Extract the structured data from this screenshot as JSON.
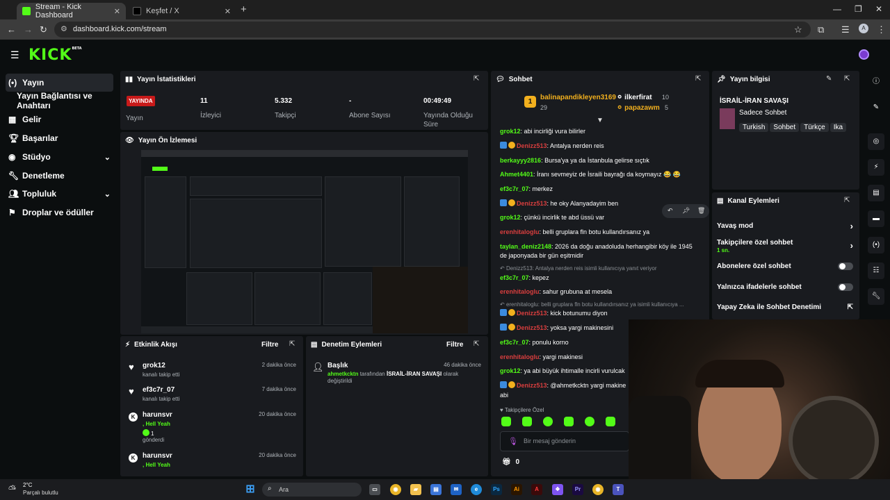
{
  "browser": {
    "tabs": [
      {
        "title": "Stream - Kick Dashboard",
        "active": true
      },
      {
        "title": "Keşfet / X",
        "active": false
      }
    ],
    "url": "dashboard.kick.com/stream",
    "profile_letter": "A"
  },
  "app": {
    "logo": "KICK",
    "logo_sup": "BETA"
  },
  "sidebar": {
    "items": [
      {
        "label": "Yayın",
        "icon": "broadcast-icon",
        "active": true
      },
      {
        "label": "Yayın Bağlantısı ve Anahtarı",
        "icon": "",
        "active": false
      },
      {
        "label": "Gelir",
        "icon": "chart-icon",
        "active": false
      },
      {
        "label": "Başarılar",
        "icon": "trophy-icon",
        "active": false
      },
      {
        "label": "Stüdyo",
        "icon": "palette-icon",
        "active": false,
        "chevron": true
      },
      {
        "label": "Denetleme",
        "icon": "wrench-icon",
        "active": false
      },
      {
        "label": "Topluluk",
        "icon": "people-icon",
        "active": false,
        "chevron": true
      },
      {
        "label": "Droplar ve ödüller",
        "icon": "gift-icon",
        "active": false
      }
    ]
  },
  "stats": {
    "title": "Yayın İstatistikleri",
    "live_badge": "YAYINDA",
    "live_label": "Yayın",
    "viewers_value": "11",
    "viewers_label": "İzleyici",
    "followers_value": "5.332",
    "followers_label": "Takipçi",
    "subs_value": "-",
    "subs_label": "Abone Sayısı",
    "duration_value": "00:49:49",
    "duration_label": "Yayında Olduğu Süre"
  },
  "preview": {
    "title": "Yayın Ön İzlemesi"
  },
  "events": {
    "title": "Etkinlik Akışı",
    "filter": "Filtre",
    "items": [
      {
        "name": "grok12",
        "sub": "kanalı takip etti",
        "time": "2 dakika önce",
        "icon": "heart-icon"
      },
      {
        "name": "ef3c7r_07",
        "sub": "kanalı takip etti",
        "time": "7 dakika önce",
        "icon": "heart-icon"
      },
      {
        "name": "harunsvr",
        "sub": ", Hell Yeah",
        "sub2": "1",
        "sub3": "gönderdi",
        "time": "20 dakika önce",
        "icon": "kick-icon"
      },
      {
        "name": "harunsvr",
        "sub": ", Hell Yeah",
        "time": "20 dakika önce",
        "icon": "kick-icon"
      }
    ]
  },
  "mod_actions": {
    "title": "Denetim Eylemleri",
    "filter": "Filtre",
    "item": {
      "title": "Başlık",
      "time": "46 dakika önce",
      "user": "ahmetkcktn",
      "middle": "tarafından",
      "target": "İSRAİL-İRAN SAVAŞI",
      "rest": "olarak",
      "rest2": "değiştirildi"
    }
  },
  "chat": {
    "title": "Sohbet",
    "top_gifter": {
      "name": "balinapandikleyen3169",
      "rank": "1",
      "count": "29"
    },
    "gifter2": {
      "name": "ilkerfirat",
      "count": "10"
    },
    "gifter3": {
      "name": "papazawm",
      "count": "5"
    },
    "messages": [
      {
        "user": "grok12",
        "color": "g",
        "text": ": abi incirliği vura bilirler"
      },
      {
        "user": "Denizz513",
        "color": "r",
        "text": ": Antalya nerden reis",
        "badges": true
      },
      {
        "user": "berkayyy2816",
        "color": "g",
        "text": ": Bursa'ya ya da İstanbula gelirse sıçtık"
      },
      {
        "user": "Ahmet4401",
        "color": "g",
        "text": ": İranı sevmeyiz de İsraili bayrağı da koymayız 😂 😂"
      },
      {
        "user": "ef3c7r_07",
        "color": "g",
        "text": ": merkez"
      },
      {
        "user": "Denizz513",
        "color": "r",
        "text": ": he oky Alanyadayim ben",
        "badges": true
      },
      {
        "user": "grok12",
        "color": "g",
        "text": ": çünkü incirlik te abd üssü var"
      },
      {
        "user": "erenhitaloglu",
        "color": "r",
        "text": ": belli gruplara fln botu kullandırsanız ya"
      },
      {
        "user": "tayIan_deniz2148",
        "color": "g",
        "text": ": 2026 da doğu anadoluda herhangibir köy ile 1945"
      },
      {
        "user": "",
        "color": "g",
        "text": "de japonyada bir gün eşitmidir"
      },
      {
        "user": "ef3c7r_07",
        "color": "g",
        "text": ": kepez"
      },
      {
        "user": "erenhitaloglu",
        "color": "r",
        "text": ": sahur grubuna at mesela"
      },
      {
        "user": "Denizz513",
        "color": "r",
        "text": ": kick botunumu diyon",
        "badges": true
      },
      {
        "user": "Denizz513",
        "color": "r",
        "text": ": yoksa yargi makinesini",
        "badges": true
      },
      {
        "user": "ef3c7r_07",
        "color": "g",
        "text": ": ponulu korno"
      },
      {
        "user": "erenhitaloglu",
        "color": "r",
        "text": ": yargi makinesi"
      },
      {
        "user": "grok12",
        "color": "g",
        "text": ": ya abi büyük ihtimalle incirli vurulcak"
      },
      {
        "user": "Denizz513",
        "color": "r",
        "text": ": @ahmetkcktn yargi makine",
        "badges": true
      },
      {
        "user": "",
        "color": "g",
        "text": "abi"
      }
    ],
    "reply1": "Denizz513: Antalya nerden reis isimli kullanıcıya yanıt veriyor",
    "reply2": "erenhitaloglu: belli gruplara fln botu kullandırsanız ya isimli kullanıcıya ...",
    "followers_only": "Takipçilere Özel",
    "input_placeholder": "Bir mesaj gönderin",
    "bottom_count": "0"
  },
  "stream_info": {
    "title": "Yayın bilgisi",
    "stream_title": "İSRAİL-İRAN SAVAŞI",
    "category": "Sadece Sohbet",
    "tags": [
      "Turkish",
      "Sohbet",
      "Türkçe",
      "Ika"
    ]
  },
  "channel_actions": {
    "title": "Kanal Eylemleri",
    "items": [
      {
        "label": "Yavaş mod",
        "type": "chevron"
      },
      {
        "label": "Takipçilere özel sohbet",
        "sub": "1 sn.",
        "type": "chevron"
      },
      {
        "label": "Abonelere özel sohbet",
        "type": "toggle"
      },
      {
        "label": "Yalnızca ifadelerle sohbet",
        "type": "toggle"
      },
      {
        "label": "Yapay Zeka ile Sohbet Denetimi",
        "type": "external"
      }
    ]
  },
  "weather": {
    "temp": "2°C",
    "desc": "Parçalı bulutlu"
  },
  "taskbar": {
    "search": "Ara"
  },
  "colors": {
    "kick_green": "#53fc18",
    "live_red": "#c81a1a",
    "panel": "#191b1f",
    "bg": "#0b0e0f"
  }
}
